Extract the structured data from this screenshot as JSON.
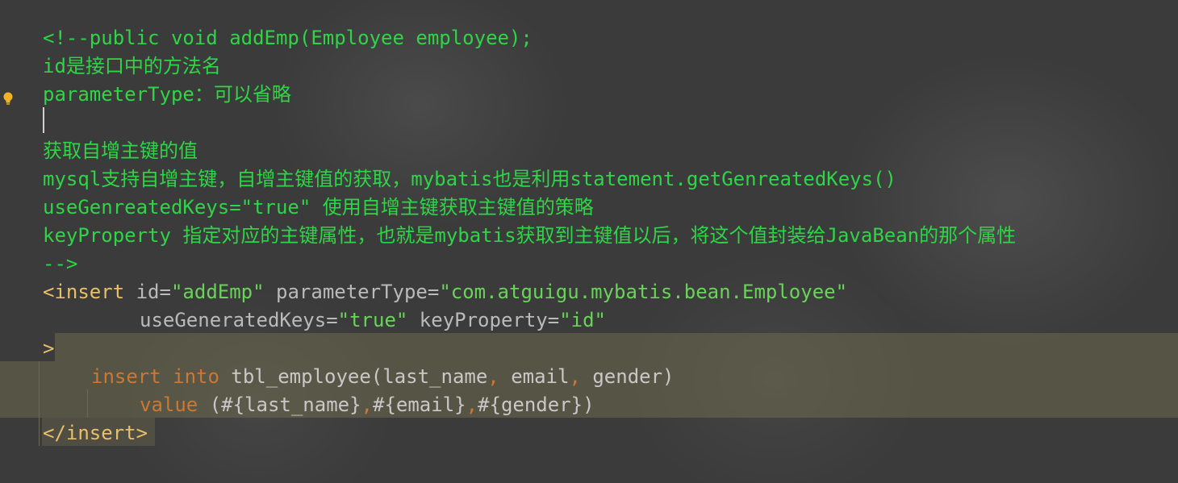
{
  "editor": {
    "comment_lines": [
      "<!--public void addEmp(Employee employee);",
      "id是接口中的方法名",
      "parameterType：可以省略",
      "",
      "获取自增主键的值",
      "mysql支持自增主键，自增主键值的获取，mybatis也是利用statement.getGenreatedKeys()",
      "useGenreatedKeys=\"true\" 使用自增主键获取主键值的策略",
      "keyProperty 指定对应的主键属性，也就是mybatis获取到主键值以后，将这个值封装给JavaBean的那个属性",
      "-->"
    ],
    "insert_open": {
      "open_bracket": "<",
      "tag": "insert",
      "attr_id": "id=",
      "val_id": "\"addEmp\"",
      "attr_param": "parameterType=",
      "val_param": "\"com.atguigu.mybatis.bean.Employee\"",
      "attr_keys": "useGeneratedKeys=",
      "val_keys": "\"true\"",
      "attr_prop": "keyProperty=",
      "val_prop": "\"id\"",
      "close_bracket": ">"
    },
    "sql": {
      "kw_insert": "insert",
      "kw_into": "into",
      "table": "tbl_employee(last_name",
      "comma1": ",",
      "col_email": " email",
      "comma2": ",",
      "col_gender": " gender)",
      "kw_value": "value",
      "v1": " (#{last_name}",
      "c1": ",",
      "v2": "#{email}",
      "c2": ",",
      "v3": "#{gender})"
    },
    "insert_close": "</insert>",
    "colors": {
      "comment": "#2fd447",
      "tag": "#e8bf6a",
      "string": "#6ad35a",
      "keyword": "#cc7832",
      "background": "#3b3b3b"
    }
  }
}
